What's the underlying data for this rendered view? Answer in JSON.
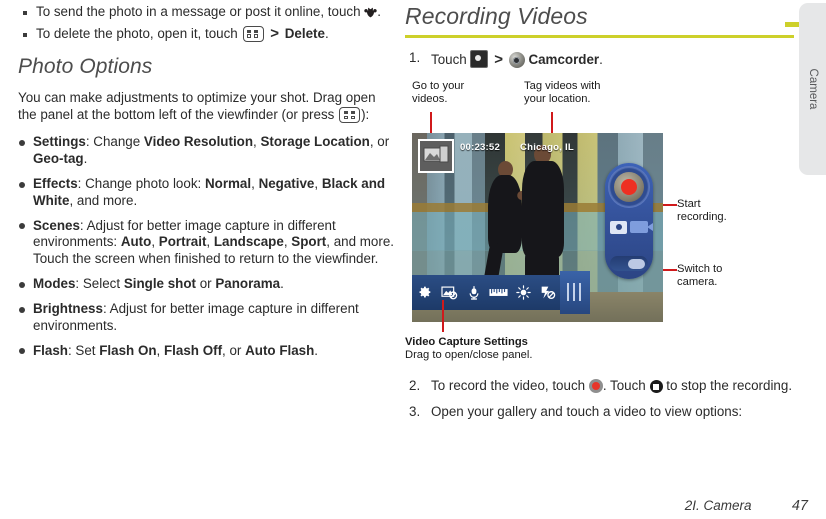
{
  "left_column": {
    "square_bullets": [
      {
        "pre": "To send the photo in a message or post it online, touch",
        "icon": "share-icon",
        "post": "."
      },
      {
        "pre": "To delete the photo, open it, touch",
        "icon": "menu-key-icon",
        "sep": ">",
        "bold": "Delete",
        "post": "."
      }
    ],
    "section_heading": "Photo Options",
    "intro_pre": "You can make adjustments to optimize your shot. Drag open the panel at the bottom left of the viewfinder (or press",
    "intro_post": "):",
    "options": [
      {
        "term": "Settings",
        "parts": [
          {
            "t": ": Change ",
            "b": false
          },
          {
            "t": "Video Resolution",
            "b": true
          },
          {
            "t": ", ",
            "b": false
          },
          {
            "t": "Storage Location",
            "b": true
          },
          {
            "t": ", or ",
            "b": false
          },
          {
            "t": "Geo-tag",
            "b": true
          },
          {
            "t": ".",
            "b": false
          }
        ]
      },
      {
        "term": "Effects",
        "parts": [
          {
            "t": ": Change photo look: ",
            "b": false
          },
          {
            "t": "Normal",
            "b": true
          },
          {
            "t": ", ",
            "b": false
          },
          {
            "t": "Negative",
            "b": true
          },
          {
            "t": ", ",
            "b": false
          },
          {
            "t": "Black and White",
            "b": true
          },
          {
            "t": ", and more.",
            "b": false
          }
        ]
      },
      {
        "term": "Scenes",
        "parts": [
          {
            "t": ": Adjust for better image capture in different environments: ",
            "b": false
          },
          {
            "t": "Auto",
            "b": true
          },
          {
            "t": ", ",
            "b": false
          },
          {
            "t": "Portrait",
            "b": true
          },
          {
            "t": ", ",
            "b": false
          },
          {
            "t": "Landscape",
            "b": true
          },
          {
            "t": ", ",
            "b": false
          },
          {
            "t": "Sport",
            "b": true
          },
          {
            "t": ", and more. Touch the screen when finished to return to the viewfinder.",
            "b": false
          }
        ]
      },
      {
        "term": "Modes",
        "parts": [
          {
            "t": ": Select ",
            "b": false
          },
          {
            "t": "Single shot",
            "b": true
          },
          {
            "t": " or ",
            "b": false
          },
          {
            "t": "Panorama",
            "b": true
          },
          {
            "t": ".",
            "b": false
          }
        ]
      },
      {
        "term": "Brightness",
        "parts": [
          {
            "t": ": Adjust for better image capture in different environments.",
            "b": false
          }
        ]
      },
      {
        "term": "Flash",
        "parts": [
          {
            "t": ": Set ",
            "b": false
          },
          {
            "t": "Flash On",
            "b": true
          },
          {
            "t": ", ",
            "b": false
          },
          {
            "t": "Flash Off",
            "b": true
          },
          {
            "t": ", or ",
            "b": false
          },
          {
            "t": "Auto Flash",
            "b": true
          },
          {
            "t": ".",
            "b": false
          }
        ]
      }
    ]
  },
  "right_column": {
    "section_heading": "Recording Videos",
    "rule_color": "#cdd02a",
    "step1": {
      "number": "1.",
      "text_pre": "Touch",
      "icon_a": "camera-app-icon",
      "separator": ">",
      "icon_b": "camcorder-icon",
      "bold_label": "Camcorder",
      "text_post": "."
    },
    "step2": {
      "number": "2.",
      "text_pre": "To record the video, touch",
      "icon_record": "record-button-icon",
      "text_mid": ". Touch",
      "icon_stop": "stop-button-icon",
      "text_post": "to stop the recording."
    },
    "step3": {
      "number": "3.",
      "text": "Open your gallery and touch a video to view options:"
    }
  },
  "callouts": [
    {
      "name": "go-to-videos",
      "line1": "Go to your",
      "line2": "videos."
    },
    {
      "name": "tag-location",
      "line1": "Tag videos with",
      "line2": "your location."
    },
    {
      "name": "start-recording",
      "line1": "Start",
      "line2": "recording."
    },
    {
      "name": "switch-camera",
      "line1": "Switch to",
      "line2": "camera."
    }
  ],
  "callout_line_color": "#d0191b",
  "caption": {
    "title": "Video Capture Settings",
    "subtitle": "Drag to open/close panel."
  },
  "viewfinder": {
    "timer": "00:23:52",
    "location": "Chicago, IL",
    "gallery_icon": "gallery-thumbnail-icon",
    "toolbar_icons": [
      "settings-gear-icon",
      "effects-icon",
      "microphone-icon",
      "resolution-icon",
      "brightness-icon",
      "flash-off-icon"
    ],
    "drag_handle": "drag-handle-icon",
    "pod": {
      "record_button": "record-button",
      "photo_mode": "photo-mode-icon",
      "video_mode": "video-mode-icon",
      "switch_toggle": "camera-switch-toggle"
    }
  },
  "side_tab": {
    "label": "Camera",
    "marker_color": "#cdd02a"
  },
  "footer": {
    "section": "2I. Camera",
    "page": "47"
  }
}
